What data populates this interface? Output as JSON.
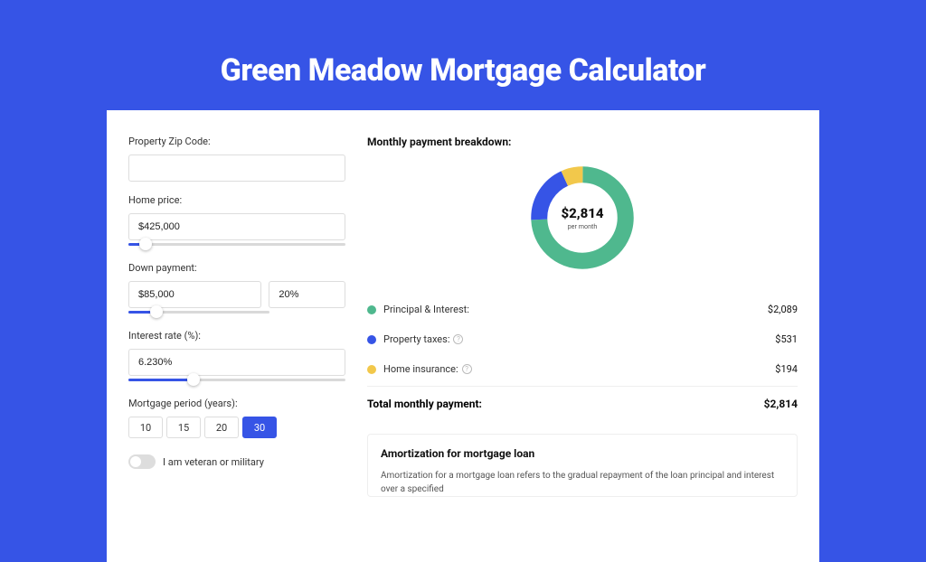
{
  "title": "Green Meadow Mortgage Calculator",
  "form": {
    "zip_label": "Property Zip Code:",
    "zip_value": "",
    "home_price_label": "Home price:",
    "home_price_value": "$425,000",
    "home_price_slider_pct": 8,
    "down_payment_label": "Down payment:",
    "down_payment_value": "$85,000",
    "down_payment_pct_value": "20%",
    "down_payment_slider_pct": 20,
    "interest_label": "Interest rate (%):",
    "interest_value": "6.230%",
    "interest_slider_pct": 30,
    "period_label": "Mortgage period (years):",
    "periods": [
      "10",
      "15",
      "20",
      "30"
    ],
    "period_active": "30",
    "veteran_label": "I am veteran or military"
  },
  "breakdown": {
    "title": "Monthly payment breakdown:",
    "total_amount": "$2,814",
    "total_sub": "per month",
    "items": [
      {
        "color": "#4fb88e",
        "label": "Principal & Interest:",
        "value": "$2,089",
        "info": false
      },
      {
        "color": "#3654e6",
        "label": "Property taxes:",
        "value": "$531",
        "info": true
      },
      {
        "color": "#f2c84b",
        "label": "Home insurance:",
        "value": "$194",
        "info": true
      }
    ],
    "total_label": "Total monthly payment:",
    "total_value": "$2,814"
  },
  "chart_data": {
    "type": "pie",
    "title": "Monthly payment breakdown",
    "series": [
      {
        "name": "Principal & Interest",
        "value": 2089,
        "color": "#4fb88e"
      },
      {
        "name": "Property taxes",
        "value": 531,
        "color": "#3654e6"
      },
      {
        "name": "Home insurance",
        "value": 194,
        "color": "#f2c84b"
      }
    ],
    "total": 2814,
    "center_label": "$2,814",
    "center_sublabel": "per month"
  },
  "amortization": {
    "title": "Amortization for mortgage loan",
    "body": "Amortization for a mortgage loan refers to the gradual repayment of the loan principal and interest over a specified"
  }
}
